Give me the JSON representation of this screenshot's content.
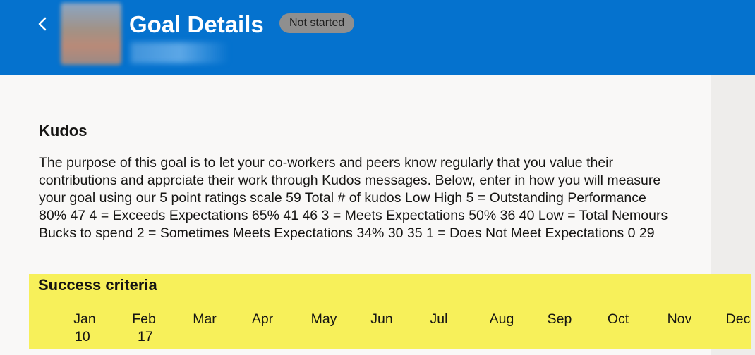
{
  "header": {
    "title": "Goal Details",
    "status": "Not started",
    "back_icon": "chevron-left-icon",
    "brand_color": "#0572ce"
  },
  "goal": {
    "name": "Kudos",
    "description": "The purpose of this goal is to let your co-workers and peers know regularly that you value their contributions and apprciate their work through Kudos messages. Below, enter in how you will measure your goal using our 5 point ratings scale 59 Total # of kudos Low High 5 = Outstanding Performance 80% 47 4 = Exceeds Expectations 65% 41 46 3 = Meets Expectations 50% 36 40 Low = Total Nemours Bucks to spend 2 = Sometimes Meets Expectations 34% 30 35 1 = Does Not Meet Expectations 0 29"
  },
  "success_criteria": {
    "label": "Success criteria",
    "highlight_color": "#f7f05a",
    "months": [
      {
        "name": "Jan",
        "value": "10"
      },
      {
        "name": "Feb",
        "value": "17"
      },
      {
        "name": "Mar",
        "value": ""
      },
      {
        "name": "Apr",
        "value": ""
      },
      {
        "name": "May",
        "value": ""
      },
      {
        "name": "Jun",
        "value": ""
      },
      {
        "name": "Jul",
        "value": ""
      },
      {
        "name": "Aug",
        "value": ""
      },
      {
        "name": "Sep",
        "value": ""
      },
      {
        "name": "Oct",
        "value": ""
      },
      {
        "name": "Nov",
        "value": ""
      },
      {
        "name": "Dec",
        "value": ""
      }
    ]
  }
}
